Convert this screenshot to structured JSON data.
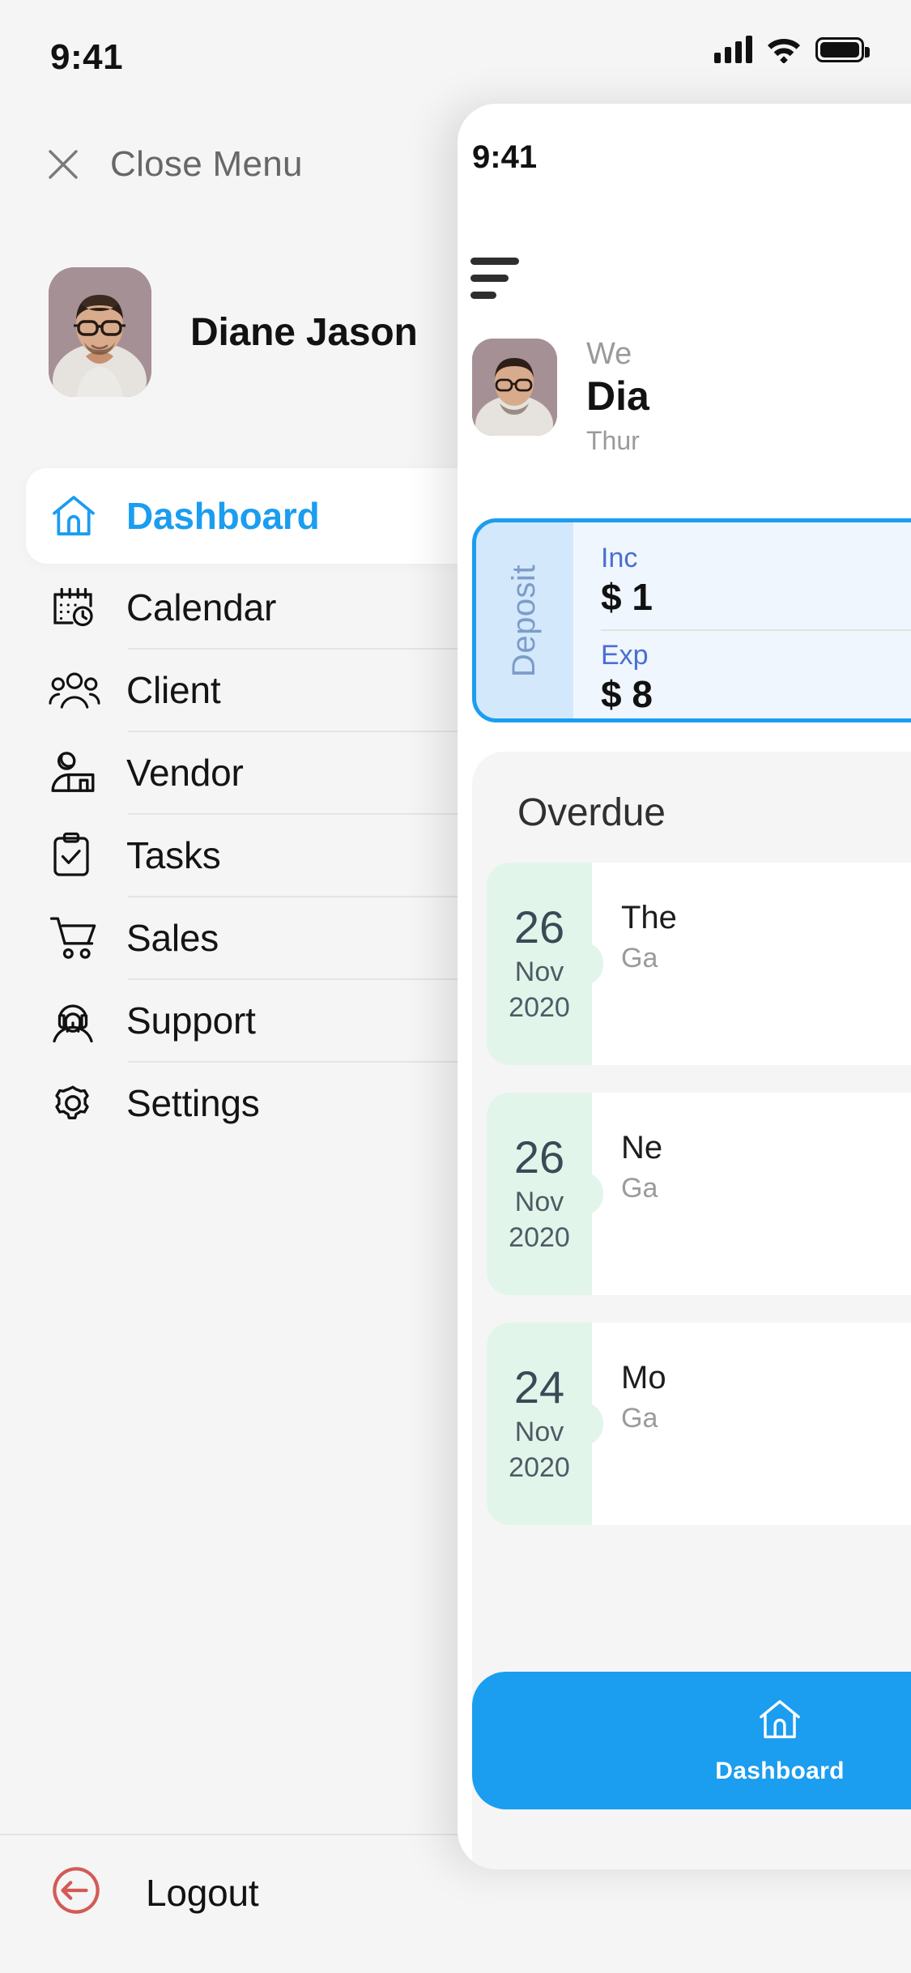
{
  "status_bar": {
    "time": "9:41",
    "icons": [
      "cellular-signal-icon",
      "wifi-icon",
      "battery-icon"
    ]
  },
  "drawer": {
    "close_menu": {
      "label": "Close Menu",
      "icon": "close-x-icon"
    },
    "profile": {
      "name": "Diane Jason",
      "avatar": "user-avatar-photo"
    },
    "nav_items": [
      {
        "label": "Dashboard",
        "icon": "home-icon",
        "active": true,
        "expandable": false
      },
      {
        "label": "Calendar",
        "icon": "calendar-clock-icon",
        "active": false,
        "expandable": false
      },
      {
        "label": "Client",
        "icon": "users-group-icon",
        "active": false,
        "expandable": false
      },
      {
        "label": "Vendor",
        "icon": "vendor-stall-icon",
        "active": false,
        "expandable": false
      },
      {
        "label": "Tasks",
        "icon": "clipboard-check-icon",
        "active": false,
        "expandable": false
      },
      {
        "label": "Sales",
        "icon": "shopping-cart-icon",
        "active": false,
        "expandable": true
      },
      {
        "label": "Support",
        "icon": "headset-agent-icon",
        "active": false,
        "expandable": true
      },
      {
        "label": "Settings",
        "icon": "gear-icon",
        "active": false,
        "expandable": false
      }
    ],
    "logout": {
      "label": "Logout",
      "icon": "logout-circle-arrow-icon"
    }
  },
  "peek_panel": {
    "status_time": "9:41",
    "menu_icon": "hamburger-menu-icon",
    "greeting": {
      "welcome": "We",
      "name": "Dia",
      "date": "Thur"
    },
    "deposit_card": {
      "side_label": "Deposit",
      "income_label": "Inc",
      "income_value": "$ 1",
      "expense_label": "Exp",
      "expense_value": "$ 8"
    },
    "overdue": {
      "title": "Overdue",
      "items": [
        {
          "day": "26",
          "month": "Nov",
          "year": "2020",
          "title": "The",
          "subtitle": "Ga"
        },
        {
          "day": "26",
          "month": "Nov",
          "year": "2020",
          "title": "Ne",
          "subtitle": "Ga"
        },
        {
          "day": "24",
          "month": "Nov",
          "year": "2020",
          "title": "Mo",
          "subtitle": "Ga"
        }
      ]
    },
    "bottom_nav": {
      "label": "Dashboard",
      "icon": "home-icon"
    }
  },
  "colors": {
    "accent_blue": "#1b9df0",
    "bg_grey": "#f5f5f5",
    "logout_red": "#d35a56",
    "date_green": "#e2f5ea",
    "deposit_fill": "#eff6fe"
  }
}
